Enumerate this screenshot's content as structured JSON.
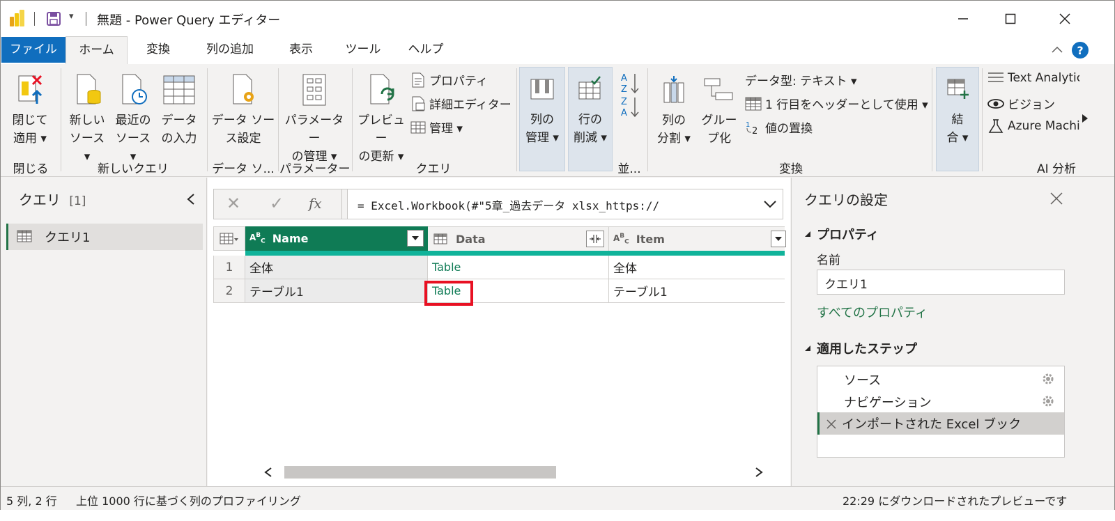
{
  "window": {
    "title": "無題 - Power Query エディター",
    "qat_dropdown": "▾"
  },
  "tabs": [
    "ファイル",
    "ホーム",
    "変換",
    "列の追加",
    "表示",
    "ツール",
    "ヘルプ"
  ],
  "ribbon": {
    "close_apply": {
      "line1": "閉じて",
      "line2": "適用 ▾"
    },
    "new_source": {
      "line1": "新しい",
      "line2": "ソース ▾"
    },
    "recent_source": {
      "line1": "最近の",
      "line2": "ソース ▾"
    },
    "enter_data": {
      "line1": "データ",
      "line2": "の入力"
    },
    "datasource_settings": {
      "line1": "データ ソー",
      "line2": "ス設定"
    },
    "manage_params": {
      "line1": "パラメーター",
      "line2": "の管理 ▾"
    },
    "refresh_preview": {
      "line1": "プレビュー",
      "line2": "の更新 ▾"
    },
    "properties": "プロパティ",
    "advanced_editor": "詳細エディター",
    "manage": "管理 ▾",
    "manage_columns": {
      "line1": "列の",
      "line2": "管理 ▾"
    },
    "reduce_rows": {
      "line1": "行の",
      "line2": "削減 ▾"
    },
    "split_column": {
      "line1": "列の",
      "line2": "分割 ▾"
    },
    "group_by": {
      "line1": "グルー",
      "line2": "プ化"
    },
    "data_type": "データ型: テキスト ▾",
    "use_first_row": "1 行目をヘッダーとして使用 ▾",
    "replace_values": "値の置換",
    "combine": {
      "line1": "結",
      "line2": "合 ▾"
    },
    "text_analytics": "Text Analytics",
    "vision": "ビジョン",
    "azure_ml": "Azure Machine Learning",
    "groups": {
      "close": "閉じる",
      "new_query": "新しいクエリ",
      "datasource": "データ ソ...",
      "params": "パラメーター",
      "query": "クエリ",
      "sort": "並...",
      "transform": "変換",
      "ai": "AI 分析"
    }
  },
  "queries_pane": {
    "title": "クエリ",
    "count": "[1]",
    "items": [
      "クエリ1"
    ]
  },
  "formula_bar": {
    "cancel": "✕",
    "confirm": "✓",
    "fx": "fx",
    "formula": "= Excel.Workbook(#\"5章_過去データ xlsx_https://"
  },
  "grid": {
    "columns": [
      {
        "type_icon": "ABC",
        "name": "Name"
      },
      {
        "type_icon": "table",
        "name": "Data"
      },
      {
        "type_icon": "ABC",
        "name": "Item"
      }
    ],
    "rows": [
      {
        "num": "1",
        "name": "全体",
        "data": "Table",
        "item": "全体"
      },
      {
        "num": "2",
        "name": "テーブル1",
        "data": "Table",
        "item": "テーブル1"
      }
    ]
  },
  "settings_pane": {
    "title": "クエリの設定",
    "properties_header": "プロパティ",
    "name_label": "名前",
    "name_value": "クエリ1",
    "all_properties_link": "すべてのプロパティ",
    "steps_header": "適用したステップ",
    "steps": [
      "ソース",
      "ナビゲーション",
      "インポートされた Excel ブック"
    ]
  },
  "status": {
    "left": "5 列, 2 行",
    "profiling": "上位 1000 行に基づく列のプロファイリング",
    "right": "22:29 にダウンロードされたプレビューです"
  },
  "colors": {
    "accent_green": "#217346",
    "header_green": "#0f7b55",
    "teal_quality": "#10b39a",
    "file_tab": "#106ebe",
    "highlight_red": "#e81123"
  }
}
